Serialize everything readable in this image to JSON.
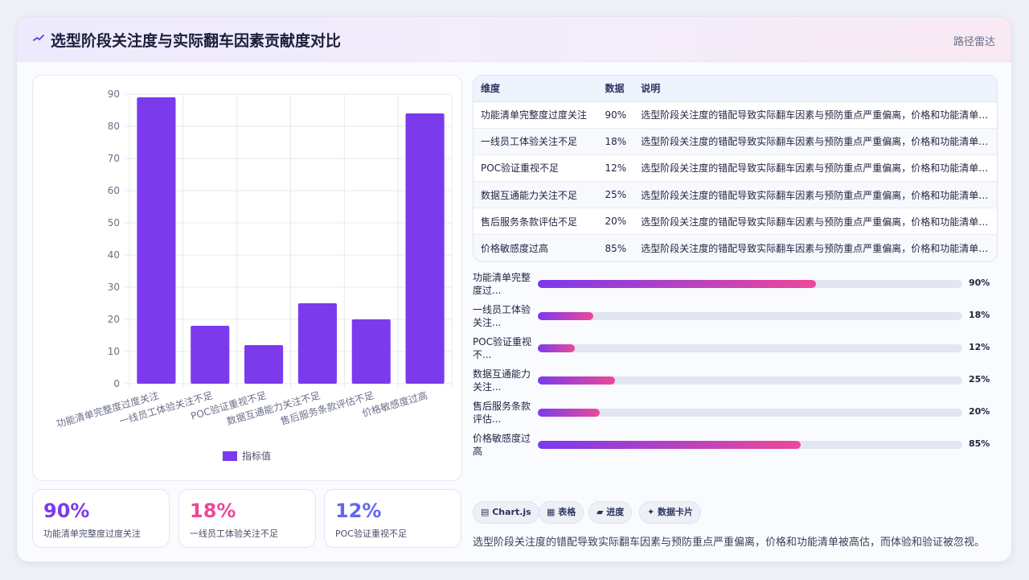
{
  "header": {
    "title": "选型阶段关注度与实际翻车因素贡献度对比",
    "tag": "路径雷达"
  },
  "colors": {
    "bar": "#7c3aed",
    "gradient_start": "#7c3aed",
    "gradient_end": "#ec4899",
    "stat1": "#7c3aed",
    "stat2": "#ec4899",
    "stat3": "#6366f1"
  },
  "chart_data": {
    "type": "bar",
    "categories": [
      "功能清单完整度过度关注",
      "一线员工体验关注不足",
      "POC验证重视不足",
      "数据互通能力关注不足",
      "售后服务条款评估不足",
      "价格敏感度过高"
    ],
    "series": [
      {
        "name": "指标值",
        "values": [
          89,
          18,
          12,
          25,
          20,
          84
        ]
      }
    ],
    "ylim": [
      0,
      90
    ],
    "yticks": [
      "0",
      "10",
      "20",
      "30",
      "40",
      "50",
      "60",
      "70",
      "80",
      "90"
    ],
    "grid": true,
    "legend": "bottom"
  },
  "stats": [
    {
      "value": "90%",
      "label": "功能清单完整度过度关注"
    },
    {
      "value": "18%",
      "label": "一线员工体验关注不足"
    },
    {
      "value": "12%",
      "label": "POC验证重视不足"
    }
  ],
  "table": {
    "headers": [
      "维度",
      "数据",
      "说明"
    ],
    "rows": [
      [
        "功能清单完整度过度关注",
        "90%",
        "选型阶段关注度的错配导致实际翻车因素与预防重点严重偏离，价格和功能清单被高估，而体验和验证被忽视。"
      ],
      [
        "一线员工体验关注不足",
        "18%",
        "选型阶段关注度的错配导致实际翻车因素与预防重点严重偏离，价格和功能清单被高估，而体验和验证被忽视。"
      ],
      [
        "POC验证重视不足",
        "12%",
        "选型阶段关注度的错配导致实际翻车因素与预防重点严重偏离，价格和功能清单被高估，而体验和验证被忽视。"
      ],
      [
        "数据互通能力关注不足",
        "25%",
        "选型阶段关注度的错配导致实际翻车因素与预防重点严重偏离，价格和功能清单被高估，而体验和验证被忽视。"
      ],
      [
        "售后服务条款评估不足",
        "20%",
        "选型阶段关注度的错配导致实际翻车因素与预防重点严重偏离，价格和功能清单被高估，而体验和验证被忽视。"
      ],
      [
        "价格敏感度过高",
        "85%",
        "选型阶段关注度的错配导致实际翻车因素与预防重点严重偏离，价格和功能清单被高估，而体验和验证被忽视。"
      ]
    ]
  },
  "progress": [
    {
      "label": "功能清单完整度过...",
      "percent": 65.6,
      "text": "90%"
    },
    {
      "label": "一线员工体验关注...",
      "percent": 13,
      "text": "18%"
    },
    {
      "label": "POC验证重视不...",
      "percent": 8.7,
      "text": "12%"
    },
    {
      "label": "数据互通能力关注...",
      "percent": 18.2,
      "text": "25%"
    },
    {
      "label": "售后服务条款评估...",
      "percent": 14.6,
      "text": "20%"
    },
    {
      "label": "价格敏感度过高",
      "percent": 61.9,
      "text": "85%"
    }
  ],
  "tags": [
    "▤ Chart.js",
    "▦ 表格",
    "▰ 进度",
    "✦ 数据卡片"
  ],
  "summary": "选型阶段关注度的错配导致实际翻车因素与预防重点严重偏离，价格和功能清单被高估，而体验和验证被忽视。"
}
